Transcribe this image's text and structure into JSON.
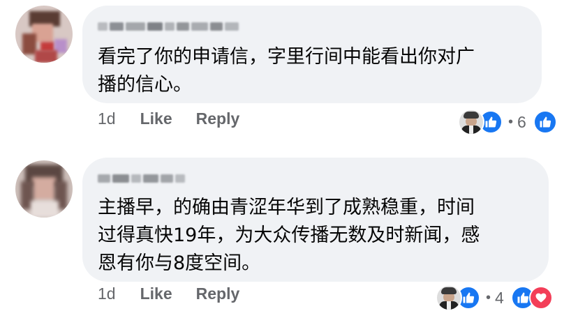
{
  "comments": [
    {
      "text_lines": [
        "看完了你的申请信，字里行间中能看出你对广",
        "播的信心。"
      ],
      "time": "1d",
      "like_label": "Like",
      "reply_label": "Reply",
      "reaction_count": "6",
      "reactions": [
        "like-icon"
      ]
    },
    {
      "text_lines": [
        "主播早，的确由青涩年华到了成熟稳重，时间",
        "过得真快19年，为大众传播无数及时新闻，感",
        "恩有你与8度空间。"
      ],
      "time": "1d",
      "like_label": "Like",
      "reply_label": "Reply",
      "reaction_count": "4",
      "reactions": [
        "like-icon",
        "love-icon"
      ]
    }
  ],
  "colors": {
    "bubble": "#f0f2f5",
    "like_blue": "#1877f2",
    "love_red": "#f33e58",
    "meta_gray": "#65676b"
  }
}
